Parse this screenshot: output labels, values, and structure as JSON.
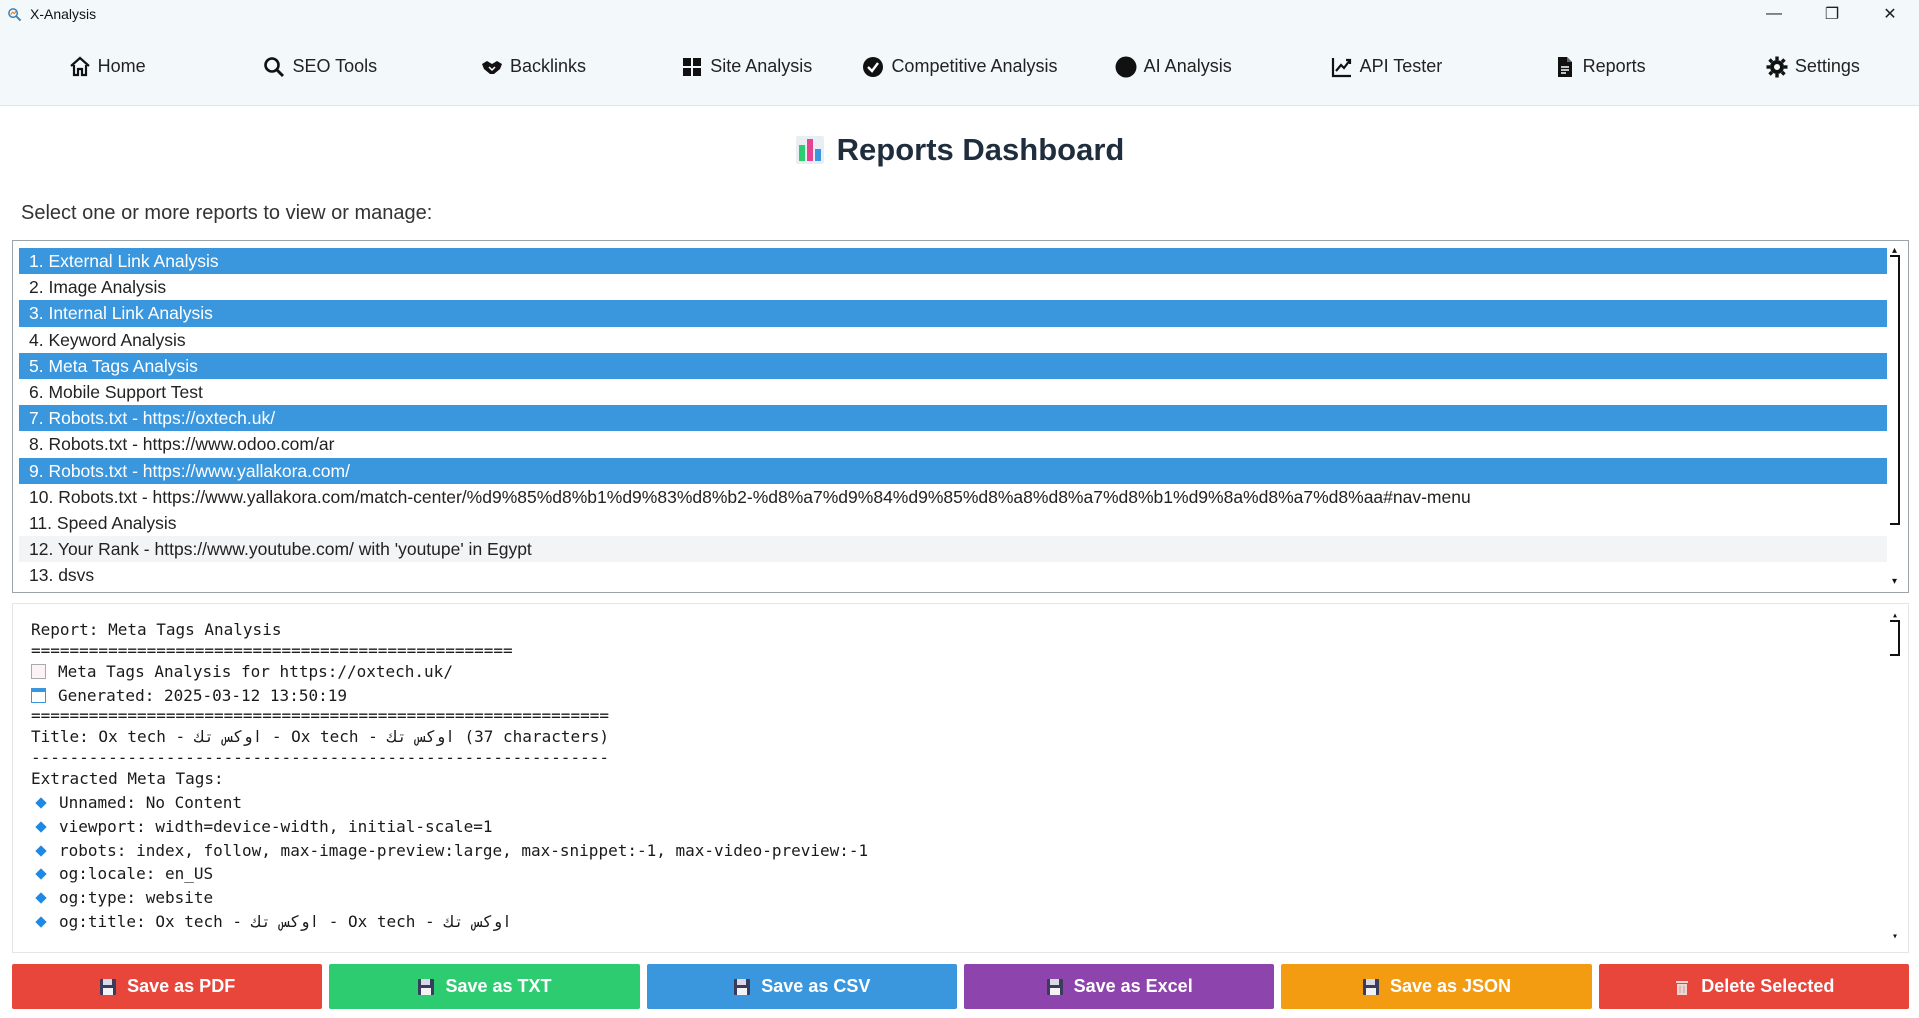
{
  "window": {
    "title": "X-Analysis",
    "minimize": "—",
    "maximize": "❐",
    "close": "✕"
  },
  "nav": [
    {
      "label": "Home",
      "icon": "home-icon"
    },
    {
      "label": "SEO Tools",
      "icon": "search-icon"
    },
    {
      "label": "Backlinks",
      "icon": "handshake-icon"
    },
    {
      "label": "Site Analysis",
      "icon": "grid-icon"
    },
    {
      "label": "Competitive Analysis",
      "icon": "check-circle-icon"
    },
    {
      "label": "AI Analysis",
      "icon": "circle-icon"
    },
    {
      "label": "API Tester",
      "icon": "chart-up-icon"
    },
    {
      "label": "Reports",
      "icon": "document-icon"
    },
    {
      "label": "Settings",
      "icon": "gear-icon"
    }
  ],
  "page_title": "Reports Dashboard",
  "prompt": "Select one or more reports to view or manage:",
  "reports": [
    {
      "label": "1. External Link Analysis",
      "selected": true
    },
    {
      "label": "2. Image Analysis",
      "selected": false
    },
    {
      "label": "3. Internal Link Analysis",
      "selected": true
    },
    {
      "label": "4. Keyword Analysis",
      "selected": false
    },
    {
      "label": "5. Meta Tags Analysis",
      "selected": true
    },
    {
      "label": "6. Mobile Support Test",
      "selected": false
    },
    {
      "label": "7. Robots.txt - https://oxtech.uk/",
      "selected": true
    },
    {
      "label": "8. Robots.txt - https://www.odoo.com/ar",
      "selected": false
    },
    {
      "label": "9. Robots.txt - https://www.yallakora.com/",
      "selected": true
    },
    {
      "label": "10. Robots.txt - https://www.yallakora.com/match-center/%d9%85%d8%b1%d9%83%d8%b2-%d8%a7%d9%84%d9%85%d8%a8%d8%a7%d8%b1%d9%8a%d8%a7%d8%aa#nav-menu",
      "selected": false
    },
    {
      "label": "11. Speed Analysis",
      "selected": false
    },
    {
      "label": "12. Your Rank - https://www.youtube.com/ with 'youtupe' in Egypt",
      "selected": false,
      "hover": true
    },
    {
      "label": "13. dsvs",
      "selected": false
    }
  ],
  "report_text": {
    "heading": "Report: Meta Tags Analysis",
    "rule1": "==================================================",
    "for_line": "Meta Tags Analysis for https://oxtech.uk/",
    "generated": "Generated: 2025-03-12 13:50:19",
    "rule2": "============================================================",
    "title_line": "Title: Ox tech - اوكس تك - Ox tech - اوكس تك (37 characters)",
    "rule3": "------------------------------------------------------------",
    "extracted": "Extracted Meta Tags:",
    "tags": [
      "Unnamed: No Content",
      "viewport: width=device-width, initial-scale=1",
      "robots: index, follow, max-image-preview:large, max-snippet:-1, max-video-preview:-1",
      "og:locale: en_US",
      "og:type: website",
      "og:title: Ox tech - اوكس تك - Ox tech - اوكس تك"
    ]
  },
  "actions": [
    {
      "label": "Save as PDF",
      "color": "#e8463b",
      "icon": "floppy-icon"
    },
    {
      "label": "Save as TXT",
      "color": "#2ecc71",
      "icon": "floppy-icon"
    },
    {
      "label": "Save as CSV",
      "color": "#3a97de",
      "icon": "floppy-icon"
    },
    {
      "label": "Save as Excel",
      "color": "#8e44ad",
      "icon": "floppy-icon"
    },
    {
      "label": "Save as JSON",
      "color": "#f39c12",
      "icon": "floppy-icon"
    },
    {
      "label": "Delete Selected",
      "color": "#e8463b",
      "icon": "trash-icon"
    }
  ]
}
